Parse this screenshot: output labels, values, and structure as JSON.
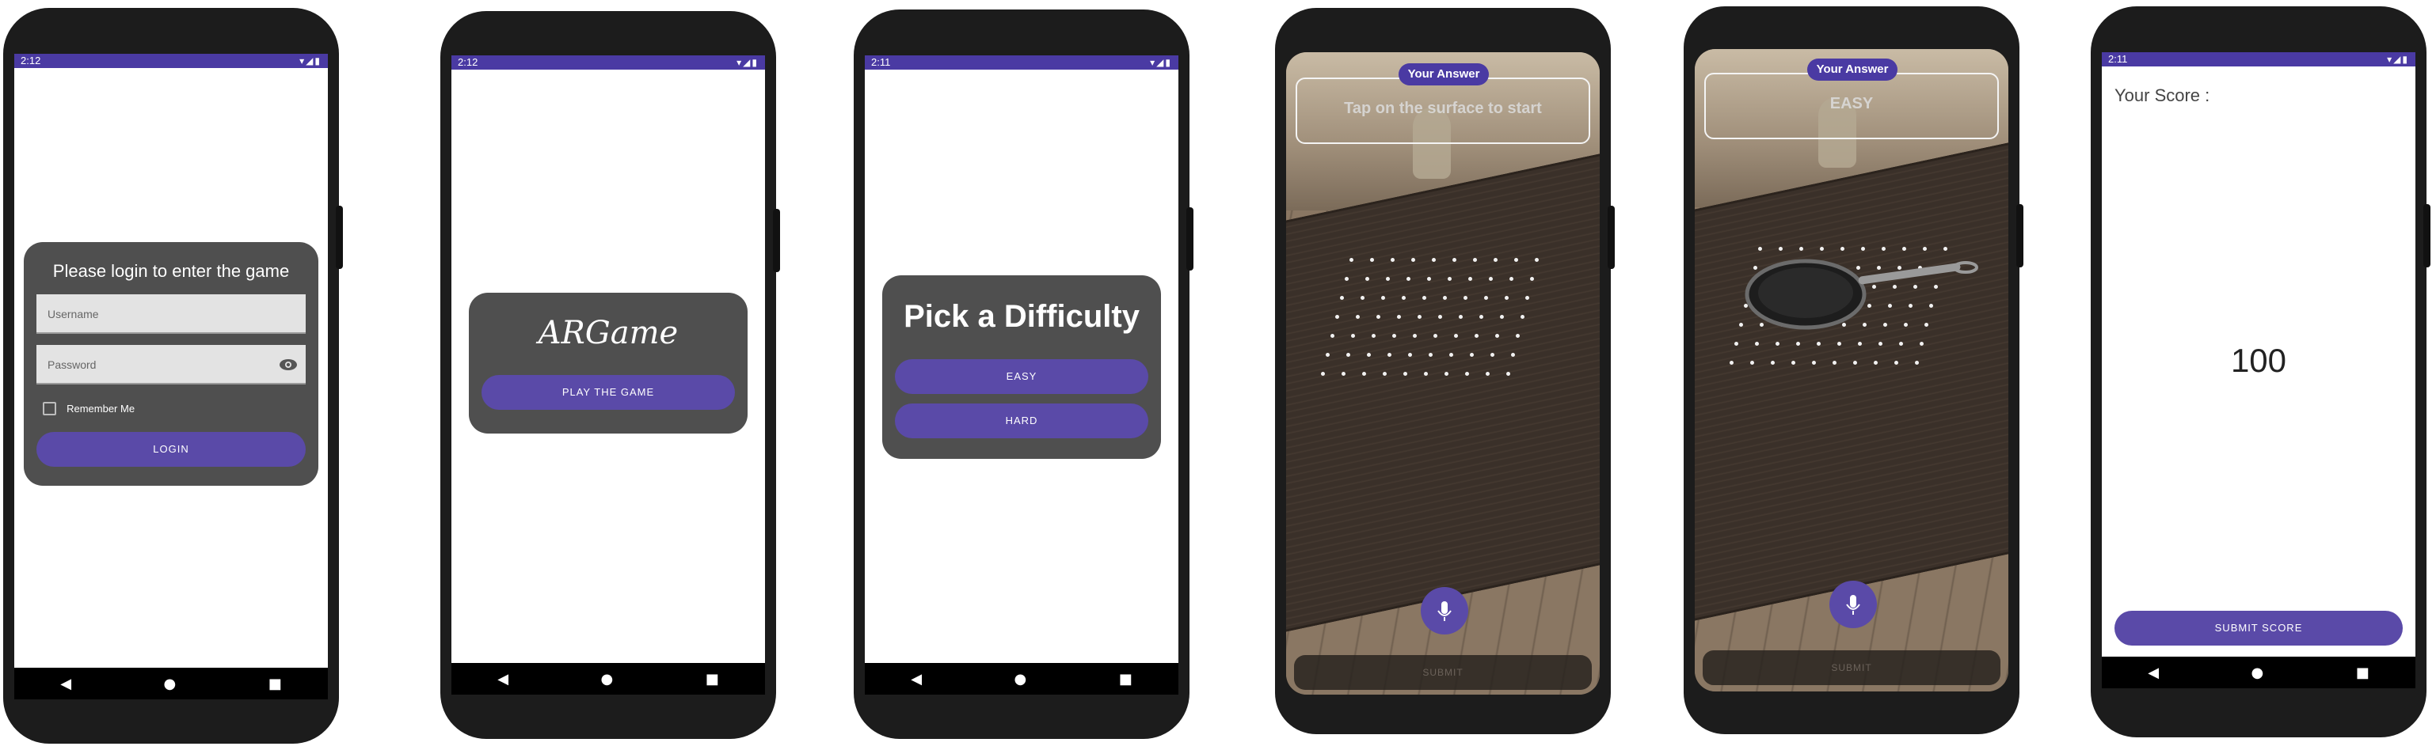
{
  "status_times": [
    "2:12",
    "2:12",
    "2:11",
    "",
    "",
    "2:11"
  ],
  "status_icons": "▾◢▮",
  "nav": {
    "back": "◀",
    "home": "●",
    "recent": "■"
  },
  "login": {
    "title": "Please login to enter the game",
    "username_placeholder": "Username",
    "password_placeholder": "Password",
    "remember_label": "Remember Me",
    "login_button": "LOGIN"
  },
  "home": {
    "logo": "ARGame",
    "play_button": "PLAY THE GAME"
  },
  "difficulty": {
    "title": "Pick a Difficulty",
    "easy_button": "EASY",
    "hard_button": "HARD"
  },
  "ar1": {
    "answer_label": "Your Answer",
    "hint": "Tap on the surface to start",
    "submit_label": "SUBMIT"
  },
  "ar2": {
    "answer_label": "Your Answer",
    "answer_value": "EASY",
    "submit_label": "SUBMIT"
  },
  "score": {
    "label": "Your Score :",
    "value": "100",
    "submit_button": "SUBMIT SCORE"
  },
  "colors": {
    "primary": "#5a4aa8",
    "status": "#4a3aa3",
    "card": "#4f4f4f"
  },
  "icons": [
    "eye-icon",
    "mic-icon",
    "back-icon",
    "home-icon",
    "recent-apps-icon",
    "checkbox-icon"
  ]
}
